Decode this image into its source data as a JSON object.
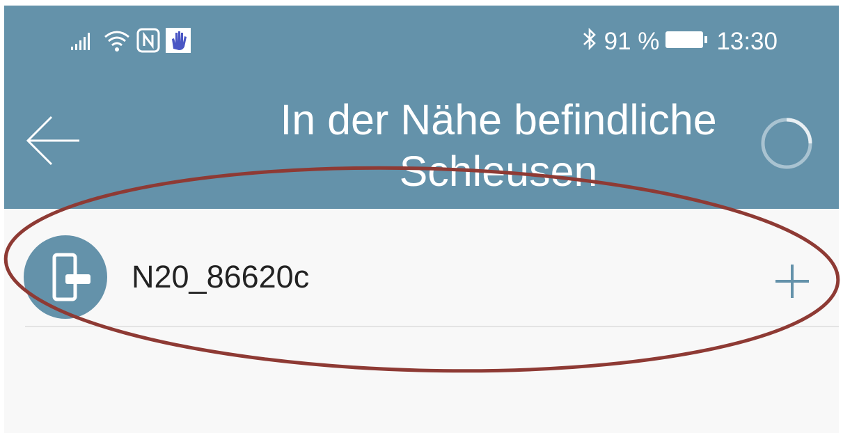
{
  "status_bar": {
    "icons": [
      "signal-icon",
      "wifi-icon",
      "nfc-icon",
      "hand-icon",
      "bluetooth-icon",
      "battery-icon"
    ],
    "battery": "91 %",
    "time": "13:30"
  },
  "header": {
    "title": "In der Nähe befindliche Schleusen",
    "back_icon": "arrow-left-icon",
    "loading_icon": "loading-spinner-icon"
  },
  "devices": [
    {
      "name": "N20_86620c",
      "icon": "door-lock-icon",
      "action_icon": "plus-icon"
    }
  ],
  "colors": {
    "header_bg": "#6492aa",
    "accent": "#6492aa",
    "annotation": "#8e3a34",
    "list_bg": "#f8f8f8"
  }
}
